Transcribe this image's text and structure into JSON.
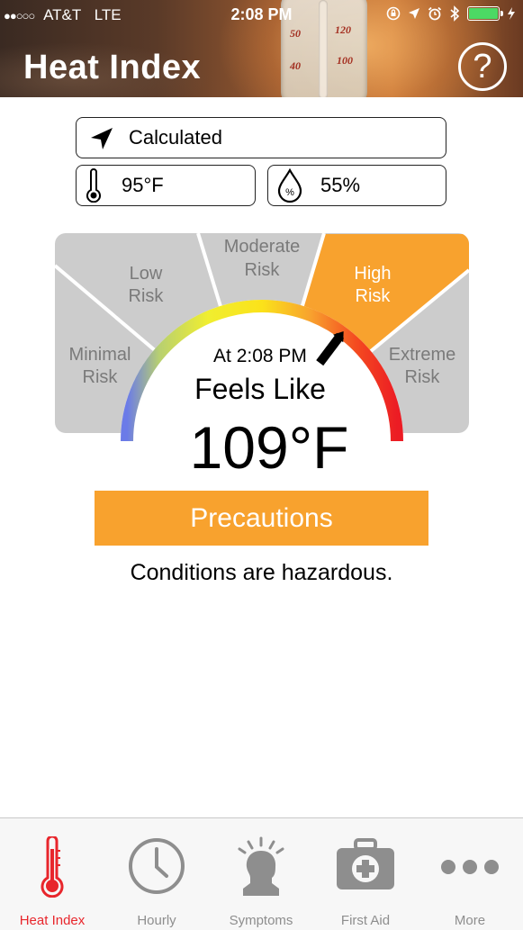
{
  "status_bar": {
    "carrier": "AT&T",
    "network": "LTE",
    "time": "2:08 PM"
  },
  "header": {
    "title": "Heat Index",
    "help_label": "?"
  },
  "inputs": {
    "location": "Calculated",
    "temperature": "95°F",
    "humidity": "55%"
  },
  "gauge": {
    "zones": [
      {
        "line1": "Minimal",
        "line2": "Risk"
      },
      {
        "line1": "Low",
        "line2": "Risk"
      },
      {
        "line1": "Moderate",
        "line2": "Risk"
      },
      {
        "line1": "High",
        "line2": "Risk"
      },
      {
        "line1": "Extreme",
        "line2": "Risk"
      }
    ],
    "active_zone": "High Risk",
    "at_time": "At 2:08 PM",
    "feels_like_label": "Feels Like",
    "feels_like_value": "109°F",
    "colors": {
      "zone_bg": "#cccccc",
      "active_bg": "#f8a22e",
      "zone_text": "#7a7a7a"
    }
  },
  "precautions": {
    "button_label": "Precautions",
    "message": "Conditions are hazardous."
  },
  "tabbar": {
    "tabs": [
      {
        "label": "Heat Index",
        "icon": "thermometer-icon",
        "active": true
      },
      {
        "label": "Hourly",
        "icon": "clock-icon",
        "active": false
      },
      {
        "label": "Symptoms",
        "icon": "head-icon",
        "active": false
      },
      {
        "label": "First Aid",
        "icon": "first-aid-kit-icon",
        "active": false
      },
      {
        "label": "More",
        "icon": "more-dots-icon",
        "active": false
      }
    ],
    "colors": {
      "active": "#e8262c",
      "inactive": "#8e8e8e"
    }
  }
}
